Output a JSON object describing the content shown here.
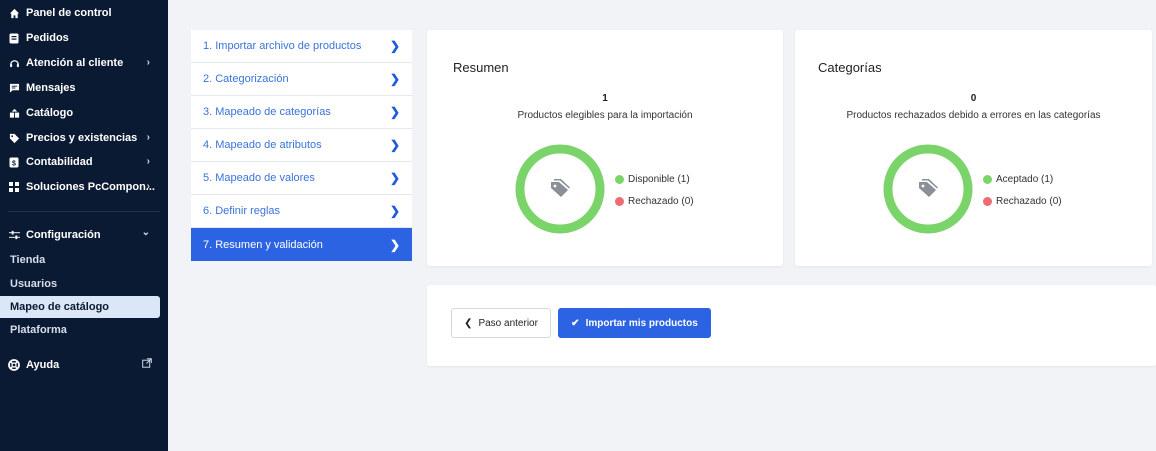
{
  "colors": {
    "sidebar_bg": "#0b1a33",
    "accent": "#2b63e3",
    "success": "#7bd46a",
    "danger": "#ef6b74"
  },
  "sidebar": {
    "items": [
      {
        "label": "Panel de control",
        "icon": "home-icon"
      },
      {
        "label": "Pedidos",
        "icon": "orders-icon"
      },
      {
        "label": "Atención al cliente",
        "icon": "headset-icon",
        "chevron": "›"
      },
      {
        "label": "Mensajes",
        "icon": "message-icon"
      },
      {
        "label": "Catálogo",
        "icon": "catalog-icon"
      },
      {
        "label": "Precios y existencias",
        "icon": "price-tag-icon",
        "chevron": "›"
      },
      {
        "label": "Contabilidad",
        "icon": "accounting-icon",
        "chevron": "›"
      },
      {
        "label": "Soluciones PcCompon...",
        "icon": "grid-icon",
        "chevron": "›"
      },
      {
        "label": "Configuración",
        "icon": "sliders-icon",
        "chevron": "⌄"
      }
    ],
    "sub_items": [
      {
        "label": "Tienda"
      },
      {
        "label": "Usuarios"
      },
      {
        "label": "Mapeo de catálogo"
      },
      {
        "label": "Plataforma"
      }
    ],
    "help": {
      "label": "Ayuda",
      "icon": "lifebuoy-icon"
    }
  },
  "steps": [
    {
      "label": "1. Importar archivo de productos"
    },
    {
      "label": "2. Categorización"
    },
    {
      "label": "3. Mapeado de categorías"
    },
    {
      "label": "4. Mapeado de atributos"
    },
    {
      "label": "5. Mapeado de valores"
    },
    {
      "label": "6. Definir reglas"
    },
    {
      "label": "7. Resumen y validación"
    }
  ],
  "summary": {
    "title": "Resumen",
    "count": "1",
    "subtitle": "Productos elegibles para la importación",
    "legend": [
      {
        "label": "Disponible (1)",
        "color": "#7bd46a",
        "value": 1
      },
      {
        "label": "Rechazado (0)",
        "color": "#ef6b74",
        "value": 0
      }
    ]
  },
  "categories": {
    "title": "Categorías",
    "count": "0",
    "subtitle": "Productos rechazados debido a errores en las categorías",
    "legend": [
      {
        "label": "Aceptado (1)",
        "color": "#7bd46a",
        "value": 1
      },
      {
        "label": "Rechazado (0)",
        "color": "#ef6b74",
        "value": 0
      }
    ]
  },
  "actions": {
    "prev_label": "Paso anterior",
    "import_label": "Importar mis productos"
  }
}
